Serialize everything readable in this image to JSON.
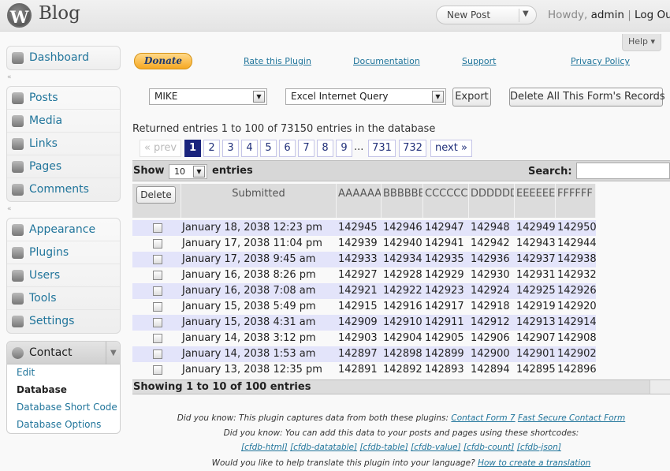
{
  "header": {
    "logo_glyph": "W",
    "site_title": "Blog",
    "new_post": "New Post",
    "howdy_prefix": "Howdy, ",
    "user": "admin",
    "separator": " | ",
    "logout": "Log Out",
    "help": "Help ▾"
  },
  "sidebar": {
    "dashboard": "Dashboard",
    "posts": "Posts",
    "media": "Media",
    "links": "Links",
    "pages": "Pages",
    "comments": "Comments",
    "appearance": "Appearance",
    "plugins": "Plugins",
    "users": "Users",
    "tools": "Tools",
    "settings": "Settings",
    "contact": "Contact",
    "sub": {
      "edit": "Edit",
      "database": "Database",
      "short_code": "Database Short Code",
      "options": "Database Options"
    }
  },
  "links": {
    "donate": "Donate",
    "rate": "Rate this Plugin",
    "documentation": "Documentation",
    "support": "Support",
    "privacy": "Privacy Policy"
  },
  "controls": {
    "form_select": "MIKE",
    "export_select": "Excel Internet Query",
    "export_button": "Export",
    "delete_all_button": "Delete All This Form's Records"
  },
  "summary": "Returned entries 1 to 100 of 73150 entries in the database",
  "pagination": {
    "prev": "« prev",
    "pages": [
      "1",
      "2",
      "3",
      "4",
      "5",
      "6",
      "7",
      "8",
      "9"
    ],
    "ellipsis": "...",
    "last_pages": [
      "731",
      "732"
    ],
    "next": "next »"
  },
  "table": {
    "show_label": "Show",
    "show_value": "10",
    "entries_label": "entries",
    "search_label": "Search:",
    "delete_button": "Delete",
    "columns": [
      "Submitted",
      "AAAAAA",
      "BBBBBB",
      "CCCCCC",
      "DDDDDD",
      "EEEEEE",
      "FFFFFF"
    ],
    "rows": [
      [
        "January 18, 2038 12:23 pm",
        "142945",
        "142946",
        "142947",
        "142948",
        "142949",
        "142950"
      ],
      [
        "January 17, 2038 11:04 pm",
        "142939",
        "142940",
        "142941",
        "142942",
        "142943",
        "142944"
      ],
      [
        "January 17, 2038 9:45 am",
        "142933",
        "142934",
        "142935",
        "142936",
        "142937",
        "142938"
      ],
      [
        "January 16, 2038 8:26 pm",
        "142927",
        "142928",
        "142929",
        "142930",
        "142931",
        "142932"
      ],
      [
        "January 16, 2038 7:08 am",
        "142921",
        "142922",
        "142923",
        "142924",
        "142925",
        "142926"
      ],
      [
        "January 15, 2038 5:49 pm",
        "142915",
        "142916",
        "142917",
        "142918",
        "142919",
        "142920"
      ],
      [
        "January 15, 2038 4:31 am",
        "142909",
        "142910",
        "142911",
        "142912",
        "142913",
        "142914"
      ],
      [
        "January 14, 2038 3:12 pm",
        "142903",
        "142904",
        "142905",
        "142906",
        "142907",
        "142908"
      ],
      [
        "January 14, 2038 1:53 am",
        "142897",
        "142898",
        "142899",
        "142900",
        "142901",
        "142902"
      ],
      [
        "January 13, 2038 12:35 pm",
        "142891",
        "142892",
        "142893",
        "142894",
        "142895",
        "142896"
      ]
    ],
    "footer": "Showing 1 to 10 of 100 entries"
  },
  "notes": {
    "line1_text": "Did you know: This plugin captures data from both these plugins: ",
    "cf7": "Contact Form 7",
    "fscf": "Fast Secure Contact Form",
    "line2_text": "Did you know: You can add this data to your posts and pages using these shortcodes:",
    "shortcodes": [
      "[cfdb-html]",
      "[cfdb-datatable]",
      "[cfdb-table]",
      "[cfdb-value]",
      "[cfdb-count]",
      "[cfdb-json]"
    ],
    "line4_text": "Would you like to help translate this plugin into your language? ",
    "translate_link": "How to create a translation"
  }
}
